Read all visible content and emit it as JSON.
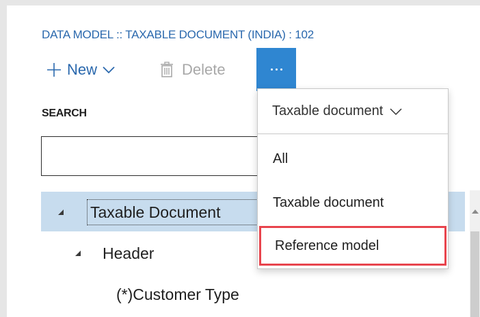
{
  "breadcrumb": "DATA MODEL :: TAXABLE DOCUMENT (INDIA) : 102",
  "toolbar": {
    "new_label": "New",
    "delete_label": "Delete",
    "more_icon": "ellipsis-icon"
  },
  "search": {
    "label": "SEARCH",
    "value": "",
    "placeholder": ""
  },
  "tree": {
    "rows": [
      {
        "label": "Taxable Document",
        "expanded": true,
        "selected": true
      },
      {
        "label": "Header",
        "expanded": true,
        "selected": false
      },
      {
        "label": "(*)Customer Type",
        "expanded": false,
        "selected": false
      }
    ]
  },
  "dropdown": {
    "selected_filter": "Taxable document",
    "items": [
      "All",
      "Taxable document",
      "Reference model"
    ],
    "highlighted_item": "Reference model",
    "highlight_color": "#e8444d"
  },
  "colors": {
    "accent": "#2f86d1",
    "link": "#2a68ad",
    "selection": "#c7dcee"
  }
}
